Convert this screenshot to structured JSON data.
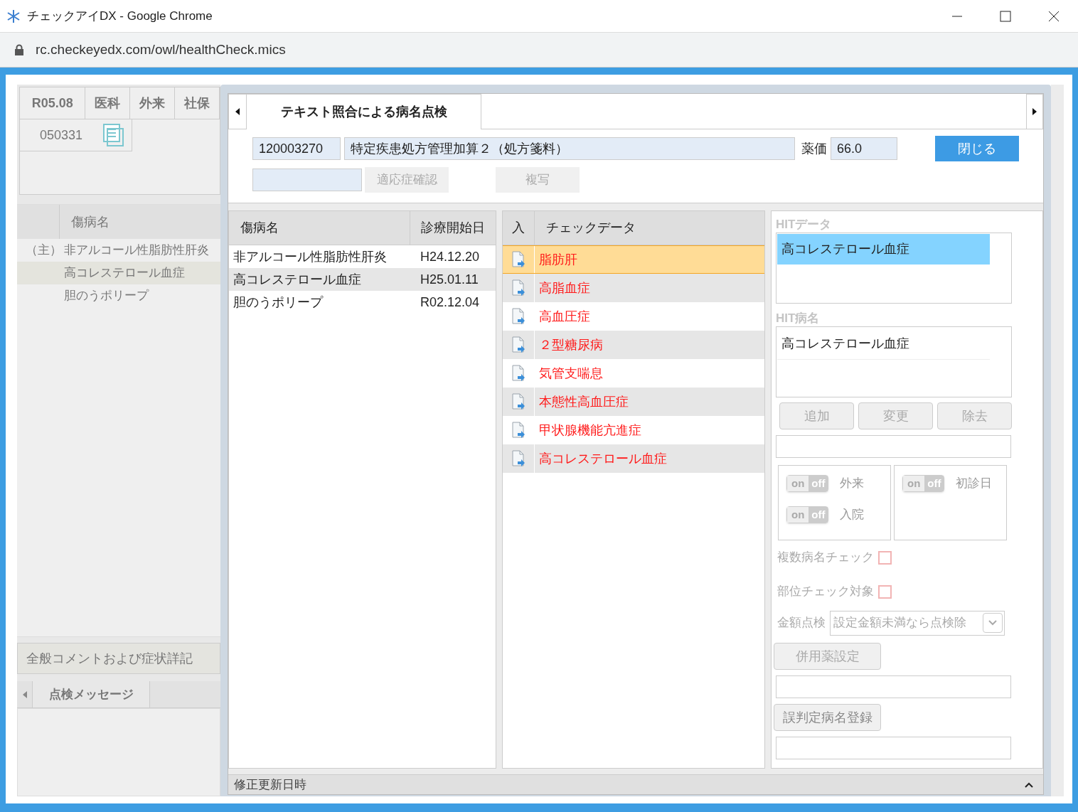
{
  "window": {
    "title": "チェックアイDX - Google Chrome",
    "url": "rc.checkeyedx.com/owl/healthCheck.mics"
  },
  "background": {
    "header_cells": [
      "R05.08",
      "医科",
      "外来",
      "社保"
    ],
    "code": "050331",
    "disease_header": "傷病名",
    "diseases": [
      {
        "mark": "（主）",
        "name": "非アルコール性脂肪性肝炎"
      },
      {
        "name": "高コレステロール血症"
      },
      {
        "name": "胆のうポリープ"
      }
    ],
    "comment_bar": "全般コメントおよび症状詳記",
    "message_tab": "点検メッセージ"
  },
  "dialog": {
    "tab": "テキスト照合による病名点検",
    "code": "120003270",
    "item_name": "特定疾患処方管理加算２（処方箋料）",
    "price_label": "薬価",
    "price": "66.0",
    "close_button": "閉じる",
    "indication_button": "適応症確認",
    "copy_button": "複写",
    "disease_table": {
      "columns": [
        "傷病名",
        "診療開始日"
      ],
      "rows": [
        [
          "非アルコール性脂肪性肝炎",
          "H24.12.20"
        ],
        [
          "高コレステロール血症",
          "H25.01.11"
        ],
        [
          "胆のうポリープ",
          "R02.12.04"
        ]
      ]
    },
    "check_table": {
      "columns": [
        "入",
        "チェックデータ"
      ],
      "rows": [
        {
          "name": "脂肪肝",
          "selected": true
        },
        {
          "name": "高脂血症",
          "selected": false
        },
        {
          "name": "高血圧症",
          "selected": false
        },
        {
          "name": "２型糖尿病",
          "selected": false
        },
        {
          "name": "気管支喘息",
          "selected": false
        },
        {
          "name": "本態性高血圧症",
          "selected": false
        },
        {
          "name": "甲状腺機能亢進症",
          "selected": false
        },
        {
          "name": "高コレステロール血症",
          "selected": false
        }
      ]
    },
    "hit_data": {
      "label": "HITデータ",
      "items": [
        {
          "name": "高コレステロール血症",
          "selected": true
        }
      ]
    },
    "hit_disease": {
      "label": "HIT病名",
      "items": [
        "高コレステロール血症"
      ]
    },
    "action_buttons": [
      "追加",
      "変更",
      "除去"
    ],
    "toggle_groups": [
      [
        {
          "on_text": "on",
          "off_text": "off",
          "label": "外来",
          "on": false
        },
        {
          "on_text": "on",
          "off_text": "off",
          "label": "入院",
          "on": false
        }
      ],
      [
        {
          "on_text": "on",
          "off_text": "off",
          "label": "初診日",
          "on": false
        }
      ]
    ],
    "checks": [
      {
        "label": "複数病名チェック",
        "checked": false
      },
      {
        "label": "部位チェック対象",
        "checked": false
      }
    ],
    "amount_check": {
      "label": "金額点検",
      "value": "設定金額未満なら点検除"
    },
    "concomitant_button": "併用薬設定",
    "misjudge_button": "誤判定病名登録",
    "footer": "修正更新日時"
  }
}
